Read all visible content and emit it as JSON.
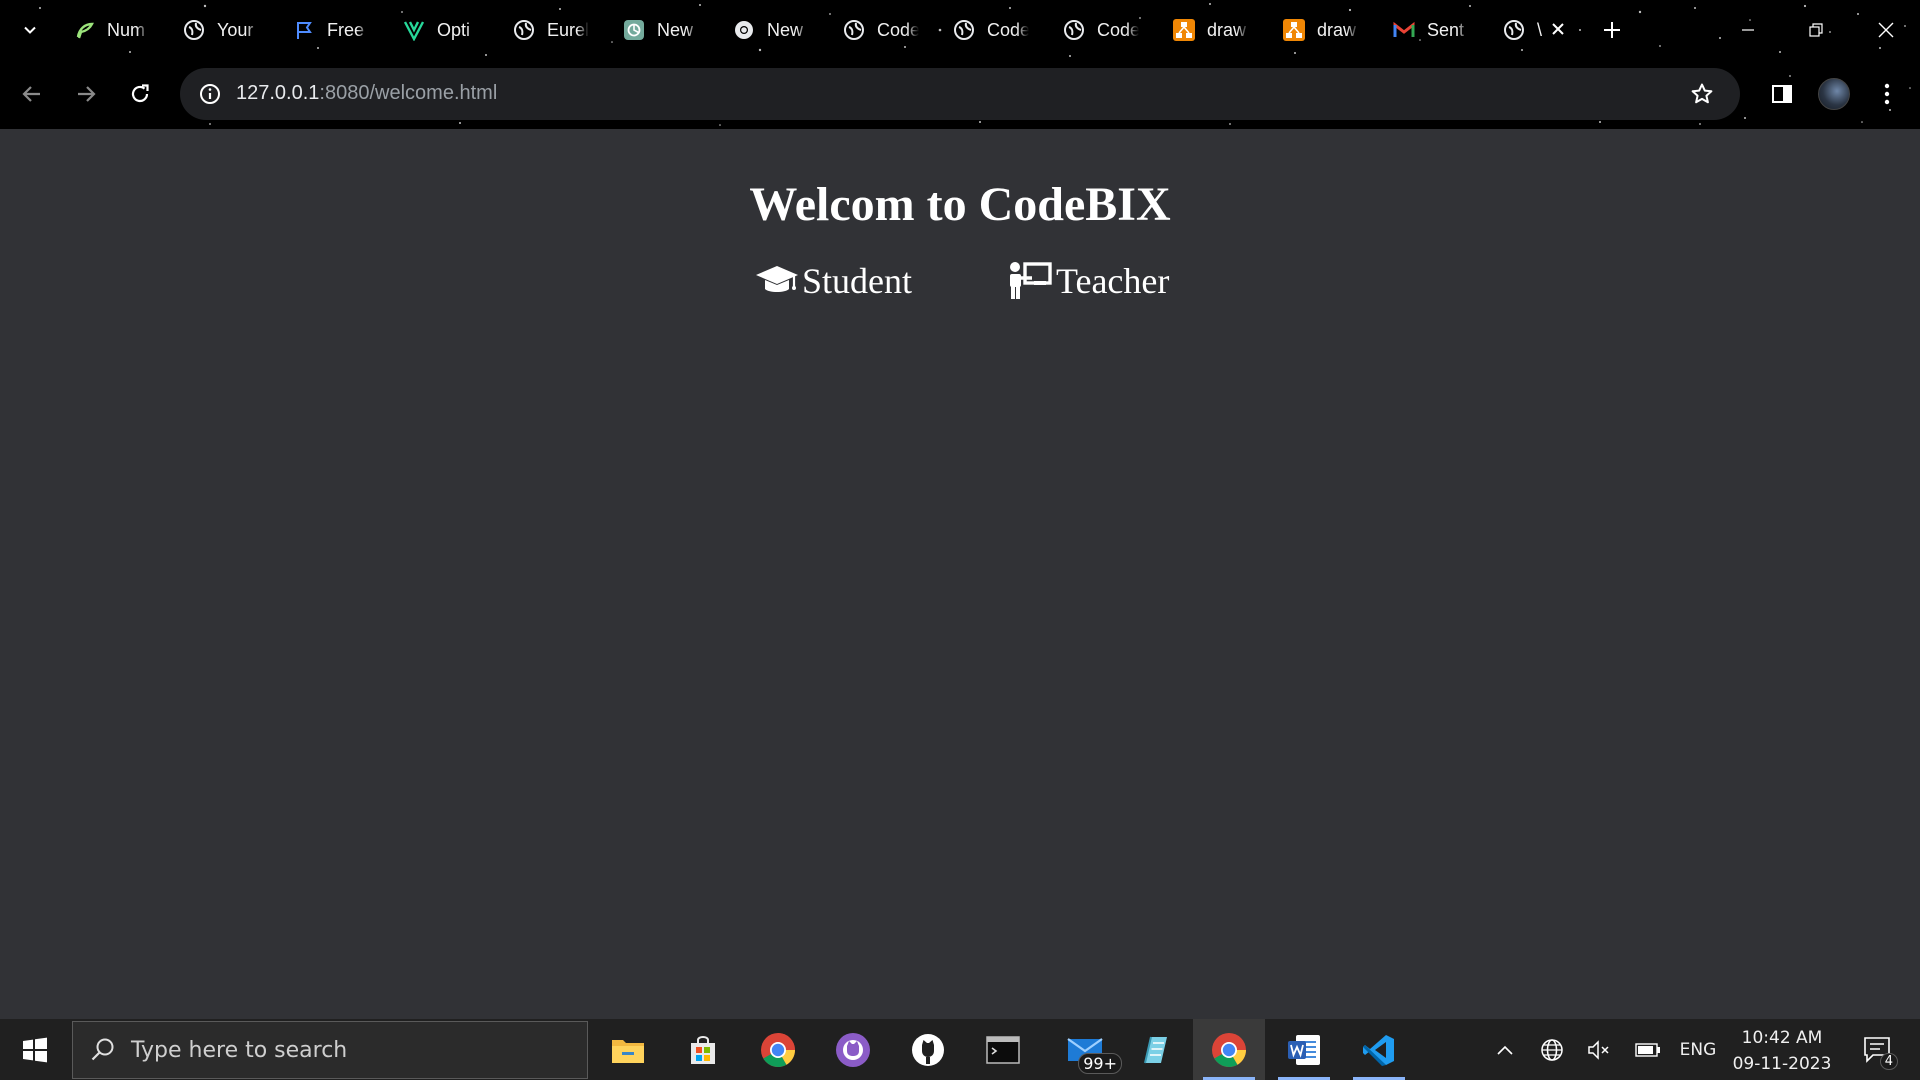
{
  "browser": {
    "tabs": [
      {
        "label": "Num",
        "icon": "fern-icon"
      },
      {
        "label": "Your",
        "icon": "globe-icon"
      },
      {
        "label": "Free",
        "icon": "flag-icon"
      },
      {
        "label": "Opti",
        "icon": "v-logo-icon"
      },
      {
        "label": "Eurel",
        "icon": "globe-icon"
      },
      {
        "label": "New",
        "icon": "openai-icon"
      },
      {
        "label": "New",
        "icon": "chrome-icon"
      },
      {
        "label": "Code",
        "icon": "globe-icon"
      },
      {
        "label": "Code",
        "icon": "globe-icon"
      },
      {
        "label": "Code",
        "icon": "globe-icon"
      },
      {
        "label": "draw",
        "icon": "drawio-icon"
      },
      {
        "label": "draw",
        "icon": "drawio-icon"
      },
      {
        "label": "Sent",
        "icon": "gmail-icon"
      },
      {
        "label": "\\",
        "icon": "globe-icon"
      }
    ],
    "url_host": "127.0.0.1",
    "url_rest": ":8080/welcome.html"
  },
  "page": {
    "title": "Welcom to CodeBIX",
    "student_label": "Student",
    "teacher_label": "Teacher"
  },
  "taskbar": {
    "search_placeholder": "Type here to search",
    "mail_badge": "99+",
    "language": "ENG",
    "time": "10:42 AM",
    "date": "09-11-2023",
    "notifications": "4"
  },
  "colors": {
    "page_bg": "#313236",
    "chrome_bg": "#000000",
    "omnibox_bg": "#1f2023",
    "taskbar_bg": "#202020",
    "accent": "#8ab4f8"
  }
}
